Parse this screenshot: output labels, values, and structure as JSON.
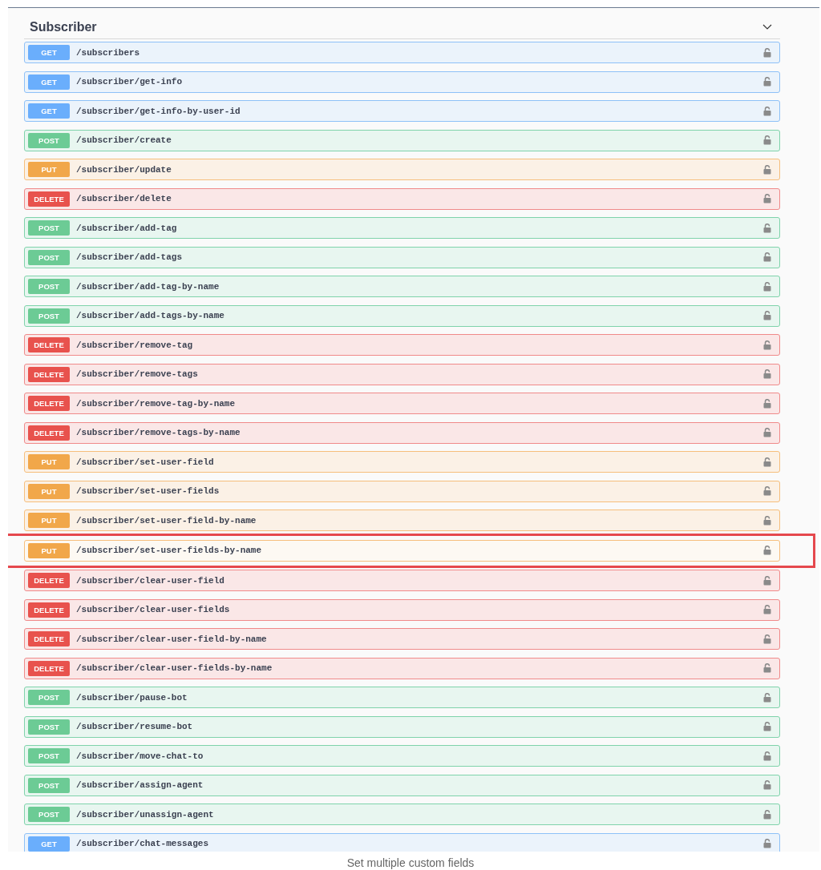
{
  "section": {
    "title": "Subscriber",
    "expanded": true
  },
  "endpoints": [
    {
      "method": "GET",
      "path": "/subscribers",
      "highlighted": false
    },
    {
      "method": "GET",
      "path": "/subscriber/get-info",
      "highlighted": false
    },
    {
      "method": "GET",
      "path": "/subscriber/get-info-by-user-id",
      "highlighted": false
    },
    {
      "method": "POST",
      "path": "/subscriber/create",
      "highlighted": false
    },
    {
      "method": "PUT",
      "path": "/subscriber/update",
      "highlighted": false
    },
    {
      "method": "DELETE",
      "path": "/subscriber/delete",
      "highlighted": false
    },
    {
      "method": "POST",
      "path": "/subscriber/add-tag",
      "highlighted": false
    },
    {
      "method": "POST",
      "path": "/subscriber/add-tags",
      "highlighted": false
    },
    {
      "method": "POST",
      "path": "/subscriber/add-tag-by-name",
      "highlighted": false
    },
    {
      "method": "POST",
      "path": "/subscriber/add-tags-by-name",
      "highlighted": false
    },
    {
      "method": "DELETE",
      "path": "/subscriber/remove-tag",
      "highlighted": false
    },
    {
      "method": "DELETE",
      "path": "/subscriber/remove-tags",
      "highlighted": false
    },
    {
      "method": "DELETE",
      "path": "/subscriber/remove-tag-by-name",
      "highlighted": false
    },
    {
      "method": "DELETE",
      "path": "/subscriber/remove-tags-by-name",
      "highlighted": false
    },
    {
      "method": "PUT",
      "path": "/subscriber/set-user-field",
      "highlighted": false
    },
    {
      "method": "PUT",
      "path": "/subscriber/set-user-fields",
      "highlighted": false
    },
    {
      "method": "PUT",
      "path": "/subscriber/set-user-field-by-name",
      "highlighted": false
    },
    {
      "method": "PUT",
      "path": "/subscriber/set-user-fields-by-name",
      "highlighted": true
    },
    {
      "method": "DELETE",
      "path": "/subscriber/clear-user-field",
      "highlighted": false
    },
    {
      "method": "DELETE",
      "path": "/subscriber/clear-user-fields",
      "highlighted": false
    },
    {
      "method": "DELETE",
      "path": "/subscriber/clear-user-field-by-name",
      "highlighted": false
    },
    {
      "method": "DELETE",
      "path": "/subscriber/clear-user-fields-by-name",
      "highlighted": false
    },
    {
      "method": "POST",
      "path": "/subscriber/pause-bot",
      "highlighted": false
    },
    {
      "method": "POST",
      "path": "/subscriber/resume-bot",
      "highlighted": false
    },
    {
      "method": "POST",
      "path": "/subscriber/move-chat-to",
      "highlighted": false
    },
    {
      "method": "POST",
      "path": "/subscriber/assign-agent",
      "highlighted": false
    },
    {
      "method": "POST",
      "path": "/subscriber/unassign-agent",
      "highlighted": false
    },
    {
      "method": "GET",
      "path": "/subscriber/chat-messages",
      "highlighted": false
    }
  ],
  "caption": "Set multiple custom fields"
}
